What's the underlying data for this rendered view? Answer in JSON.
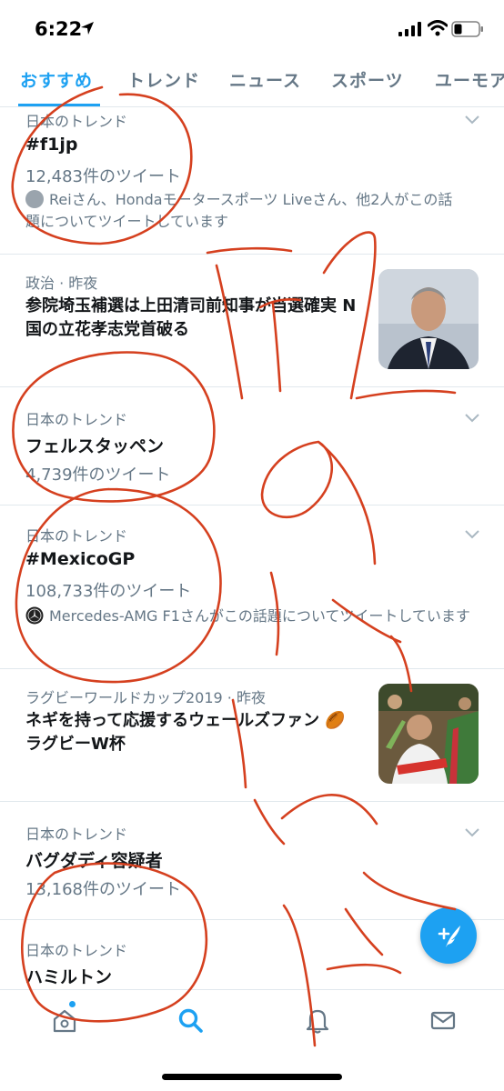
{
  "status_bar": {
    "time": "6:22"
  },
  "tabs": [
    {
      "label": "おすすめ",
      "active": true
    },
    {
      "label": "トレンド",
      "active": false
    },
    {
      "label": "ニュース",
      "active": false
    },
    {
      "label": "スポーツ",
      "active": false
    },
    {
      "label": "ユーモア",
      "active": false
    }
  ],
  "trends": [
    {
      "meta": "日本のトレンド",
      "title": "#f1jp",
      "count": "12,483件のツイート",
      "context": "Reiさん、Hondaモータースポーツ Liveさん、他2人がこの話題についてツイートしています"
    },
    {
      "meta": "政治 · 昨夜",
      "headline": "参院埼玉補選は上田清司前知事が当選確実 N国の立花孝志党首破る"
    },
    {
      "meta": "日本のトレンド",
      "title": "フェルスタッペン",
      "count": "4,739件のツイート"
    },
    {
      "meta": "日本のトレンド",
      "title": "#MexicoGP",
      "count": "108,733件のツイート",
      "context": "Mercedes-AMG F1さんがこの話題についてツイートしています"
    },
    {
      "meta": "ラグビーワールドカップ2019 · 昨夜",
      "headline": "ネギを持って応援するウェールズファン 🏉 ラグビーW杯"
    },
    {
      "meta": "日本のトレンド",
      "title": "バグダディ容疑者",
      "count": "13,168件のツイート"
    },
    {
      "meta": "日本のトレンド",
      "title": "ハミルトン"
    }
  ],
  "colors": {
    "accent": "#1da1f2",
    "secondary_text": "#657786",
    "primary_text": "#14171a",
    "annotation_ink": "#d5401f"
  },
  "icons": {
    "fab": "compose-tweet-icon",
    "bottom_nav": [
      "home-icon",
      "search-icon",
      "bell-icon",
      "mail-icon"
    ]
  }
}
